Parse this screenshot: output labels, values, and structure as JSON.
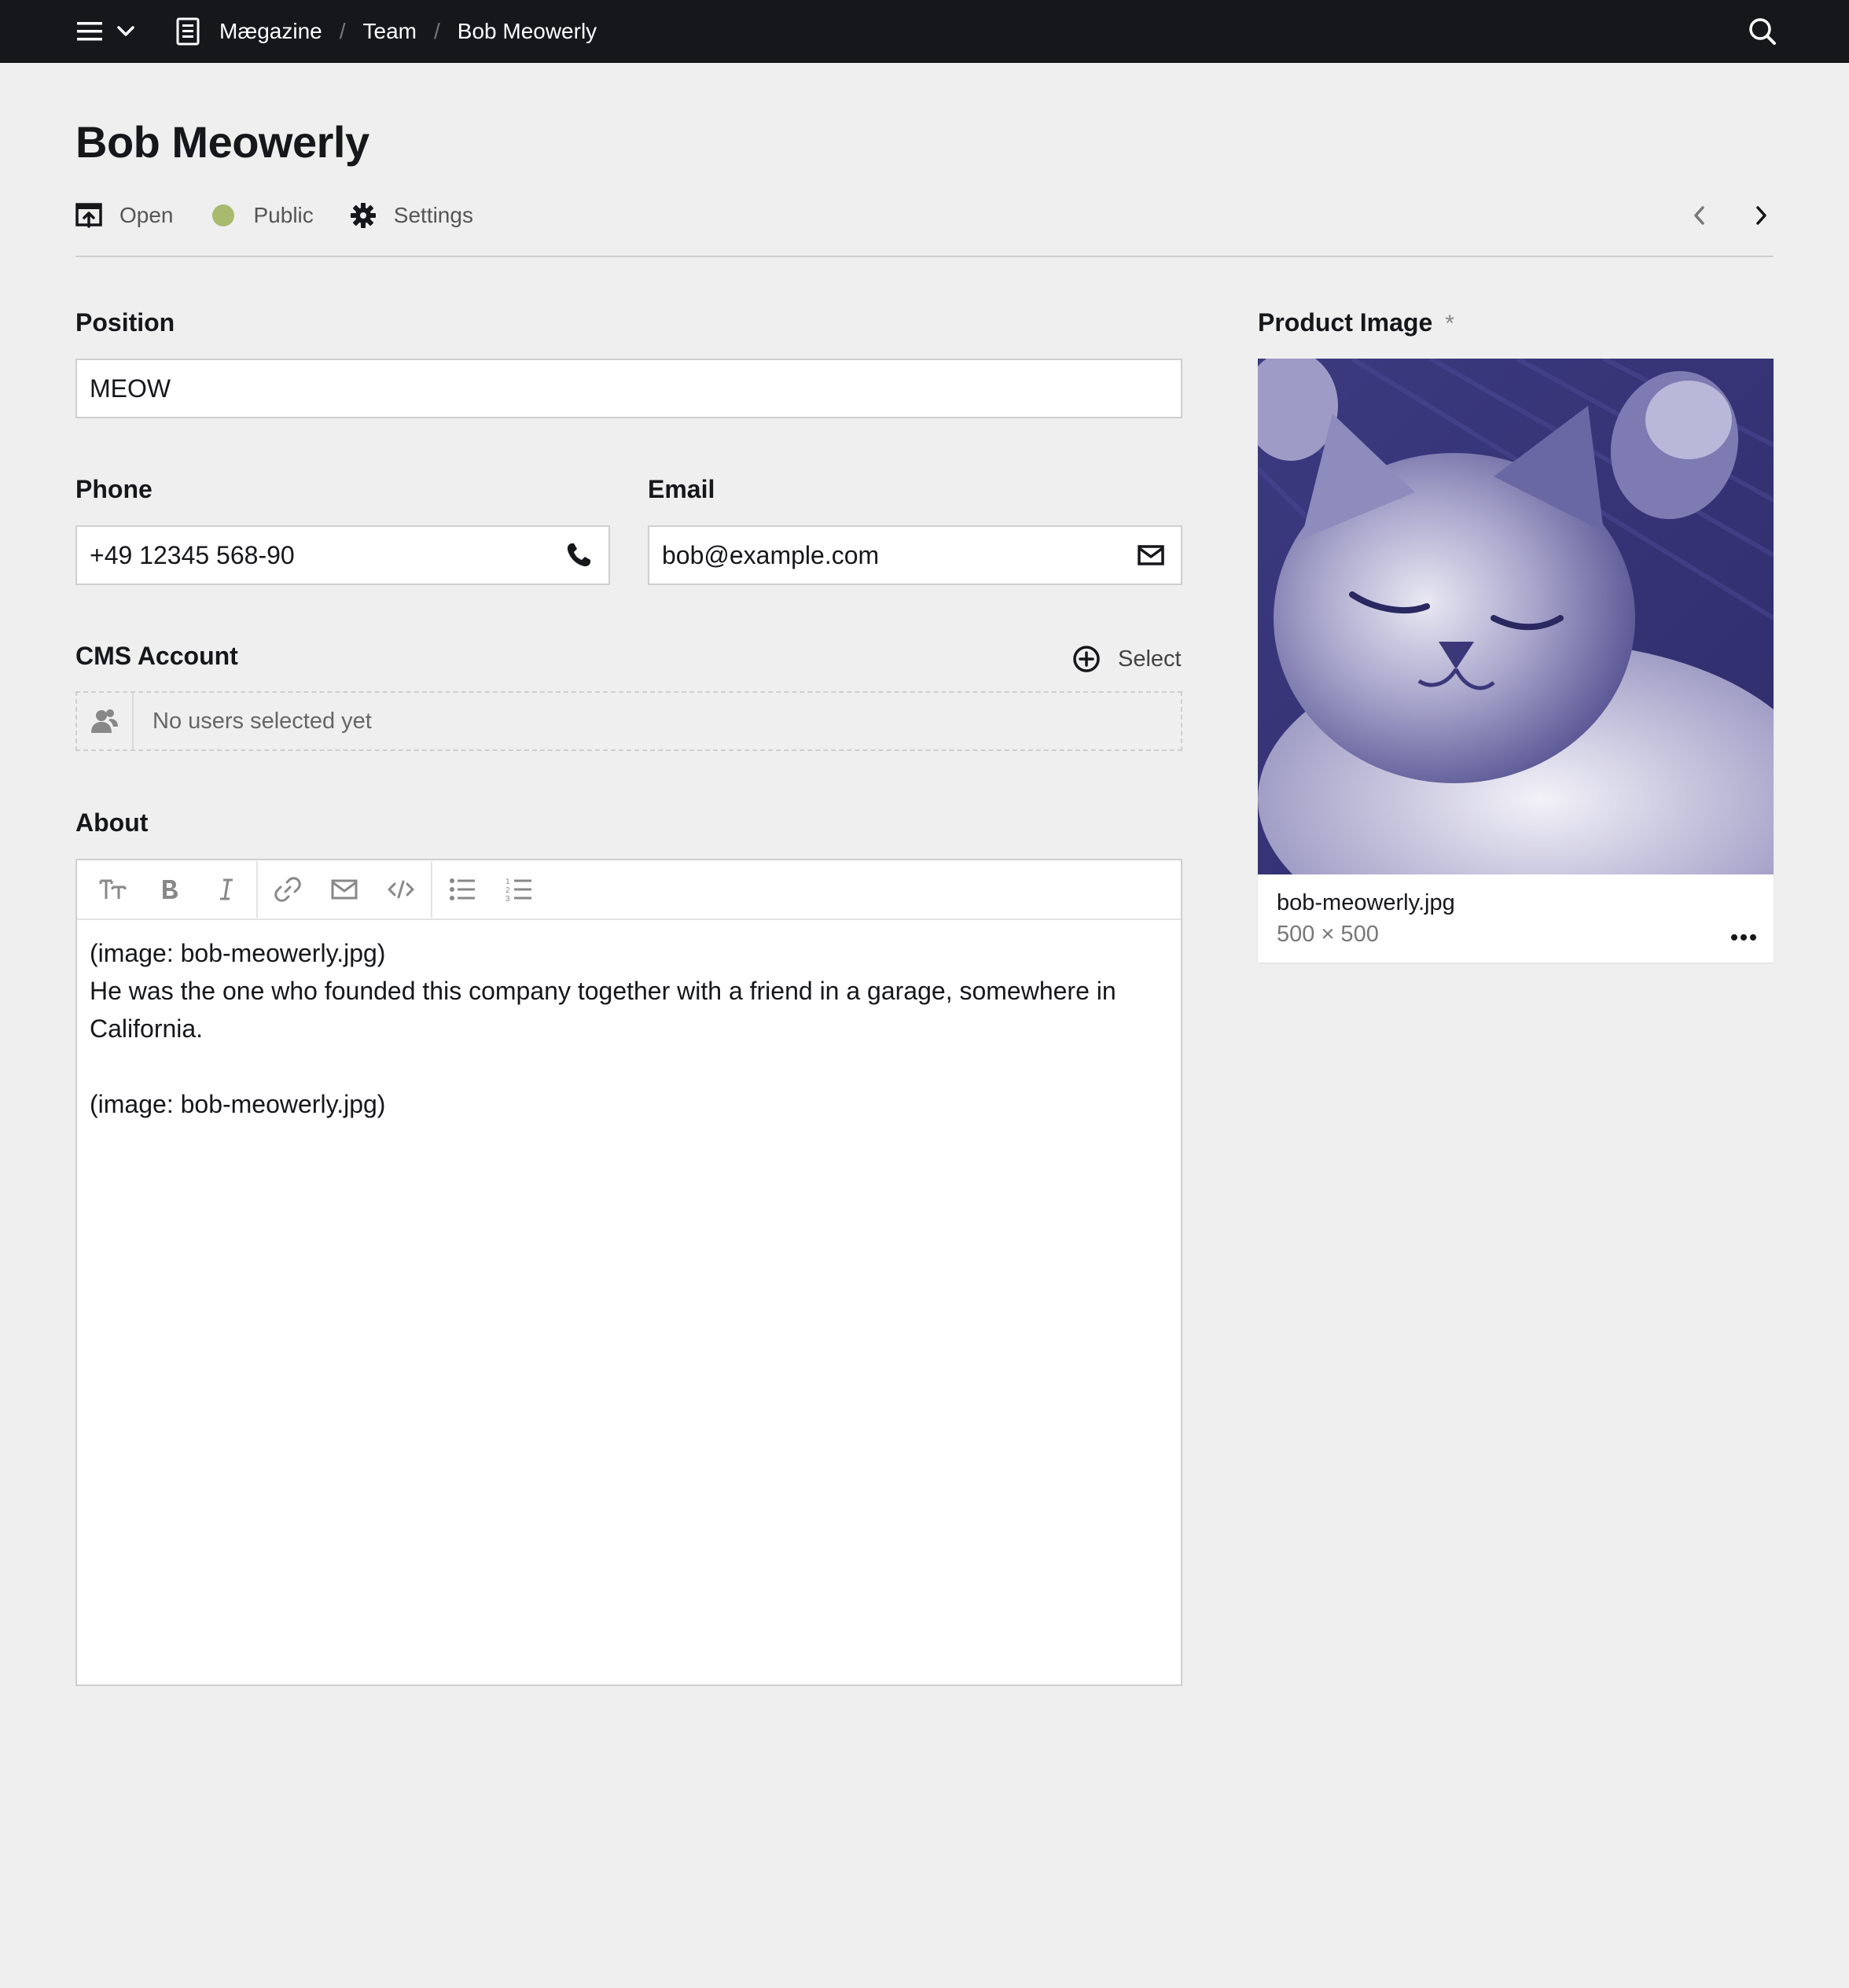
{
  "topbar": {
    "breadcrumbs": [
      "Mægazine",
      "Team",
      "Bob Meowerly"
    ],
    "separator": "/",
    "icons": [
      "menu-icon",
      "chevron-down-icon",
      "document-icon",
      "search-icon"
    ]
  },
  "header": {
    "title": "Bob Meowerly",
    "actions": {
      "open": "Open",
      "status": "Public",
      "settings": "Settings"
    },
    "status_color": "#a7ba6e"
  },
  "fields": {
    "position": {
      "label": "Position",
      "value": "MEOW"
    },
    "phone": {
      "label": "Phone",
      "value": "+49 12345 568-90",
      "icon": "phone-icon"
    },
    "email": {
      "label": "Email",
      "value": "bob@example.com",
      "icon": "envelope-icon"
    },
    "cms_account": {
      "label": "CMS Account",
      "select_label": "Select",
      "empty_text": "No users selected yet"
    },
    "about": {
      "label": "About",
      "toolbar_icons": [
        "headings-icon",
        "bold-icon",
        "italic-icon",
        "link-icon",
        "email-link-icon",
        "code-icon",
        "bullet-list-icon",
        "ordered-list-icon"
      ],
      "paragraphs": [
        "(image: bob-meowerly.jpg)\nHe was the one who founded this company together with a friend in a garage, somewhere in California.",
        "(image: bob-meowerly.jpg)"
      ]
    }
  },
  "product_image": {
    "label": "Product Image",
    "required_mark": "*",
    "filename": "bob-meowerly.jpg",
    "dimensions": "500 × 500",
    "tint_color": "#4b4891"
  },
  "colors": {
    "topbar_bg": "#16171a",
    "page_bg": "#efefef",
    "accent_status": "#a7ba6e"
  }
}
